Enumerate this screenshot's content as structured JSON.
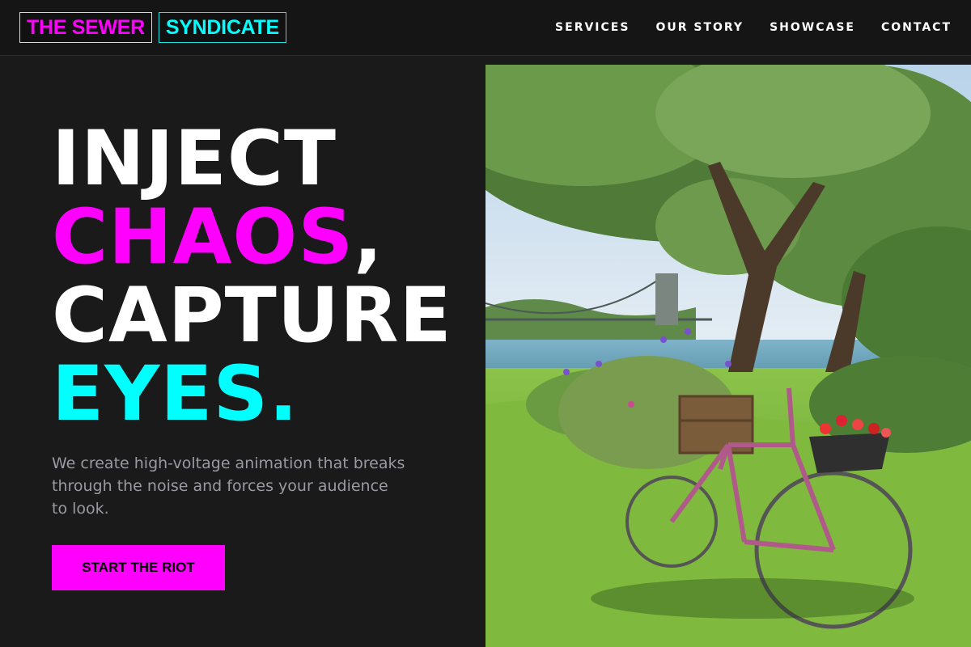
{
  "brand": {
    "part1": "THE SEWER",
    "part2": "SYNDICATE"
  },
  "nav": {
    "items": [
      {
        "label": "SERVICES"
      },
      {
        "label": "OUR STORY"
      },
      {
        "label": "SHOWCASE"
      },
      {
        "label": "CONTACT"
      }
    ]
  },
  "hero": {
    "headline": {
      "line1": "INJECT",
      "line2_highlight": "CHAOS",
      "line2_suffix": ",",
      "line3": "CAPTURE",
      "line4": "EYES."
    },
    "subtitle": "We create high-voltage animation that breaks through the noise and forces your audience to look.",
    "cta_label": "START THE RIOT",
    "image": {
      "subject": "pink bicycle with flower baskets under a tree beside a river and suspension bridge"
    }
  },
  "colors": {
    "background": "#1a1a1a",
    "accent_magenta": "#ff00ff",
    "accent_cyan": "#00ffff",
    "text_muted": "#9a9aa2"
  }
}
